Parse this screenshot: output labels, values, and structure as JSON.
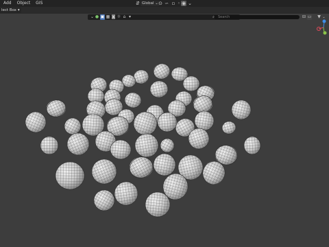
{
  "menubar": {
    "items": [
      "Add",
      "Object",
      "GIS"
    ],
    "transform_orientation": "Global",
    "icons": [
      "orientation-icon",
      "pivot-icon",
      "snap-icon",
      "proportional-edit-icon",
      "falloff-icon"
    ]
  },
  "toolbar": {
    "select_box": "lect Box ▾",
    "outliner_filters": [
      "funnel-icon",
      "object-icon",
      "mesh-icon",
      "camera-icon",
      "light-icon",
      "empty-icon"
    ],
    "search_placeholder": "Search"
  },
  "gizmo": {
    "colors": {
      "x": "#e34b5b",
      "y": "#8bc34a",
      "z": "#3f8ee8"
    }
  },
  "colors": {
    "viewport_bg": "#3d3d3d",
    "header_bg": "#232323",
    "accent": "#4772b3"
  }
}
